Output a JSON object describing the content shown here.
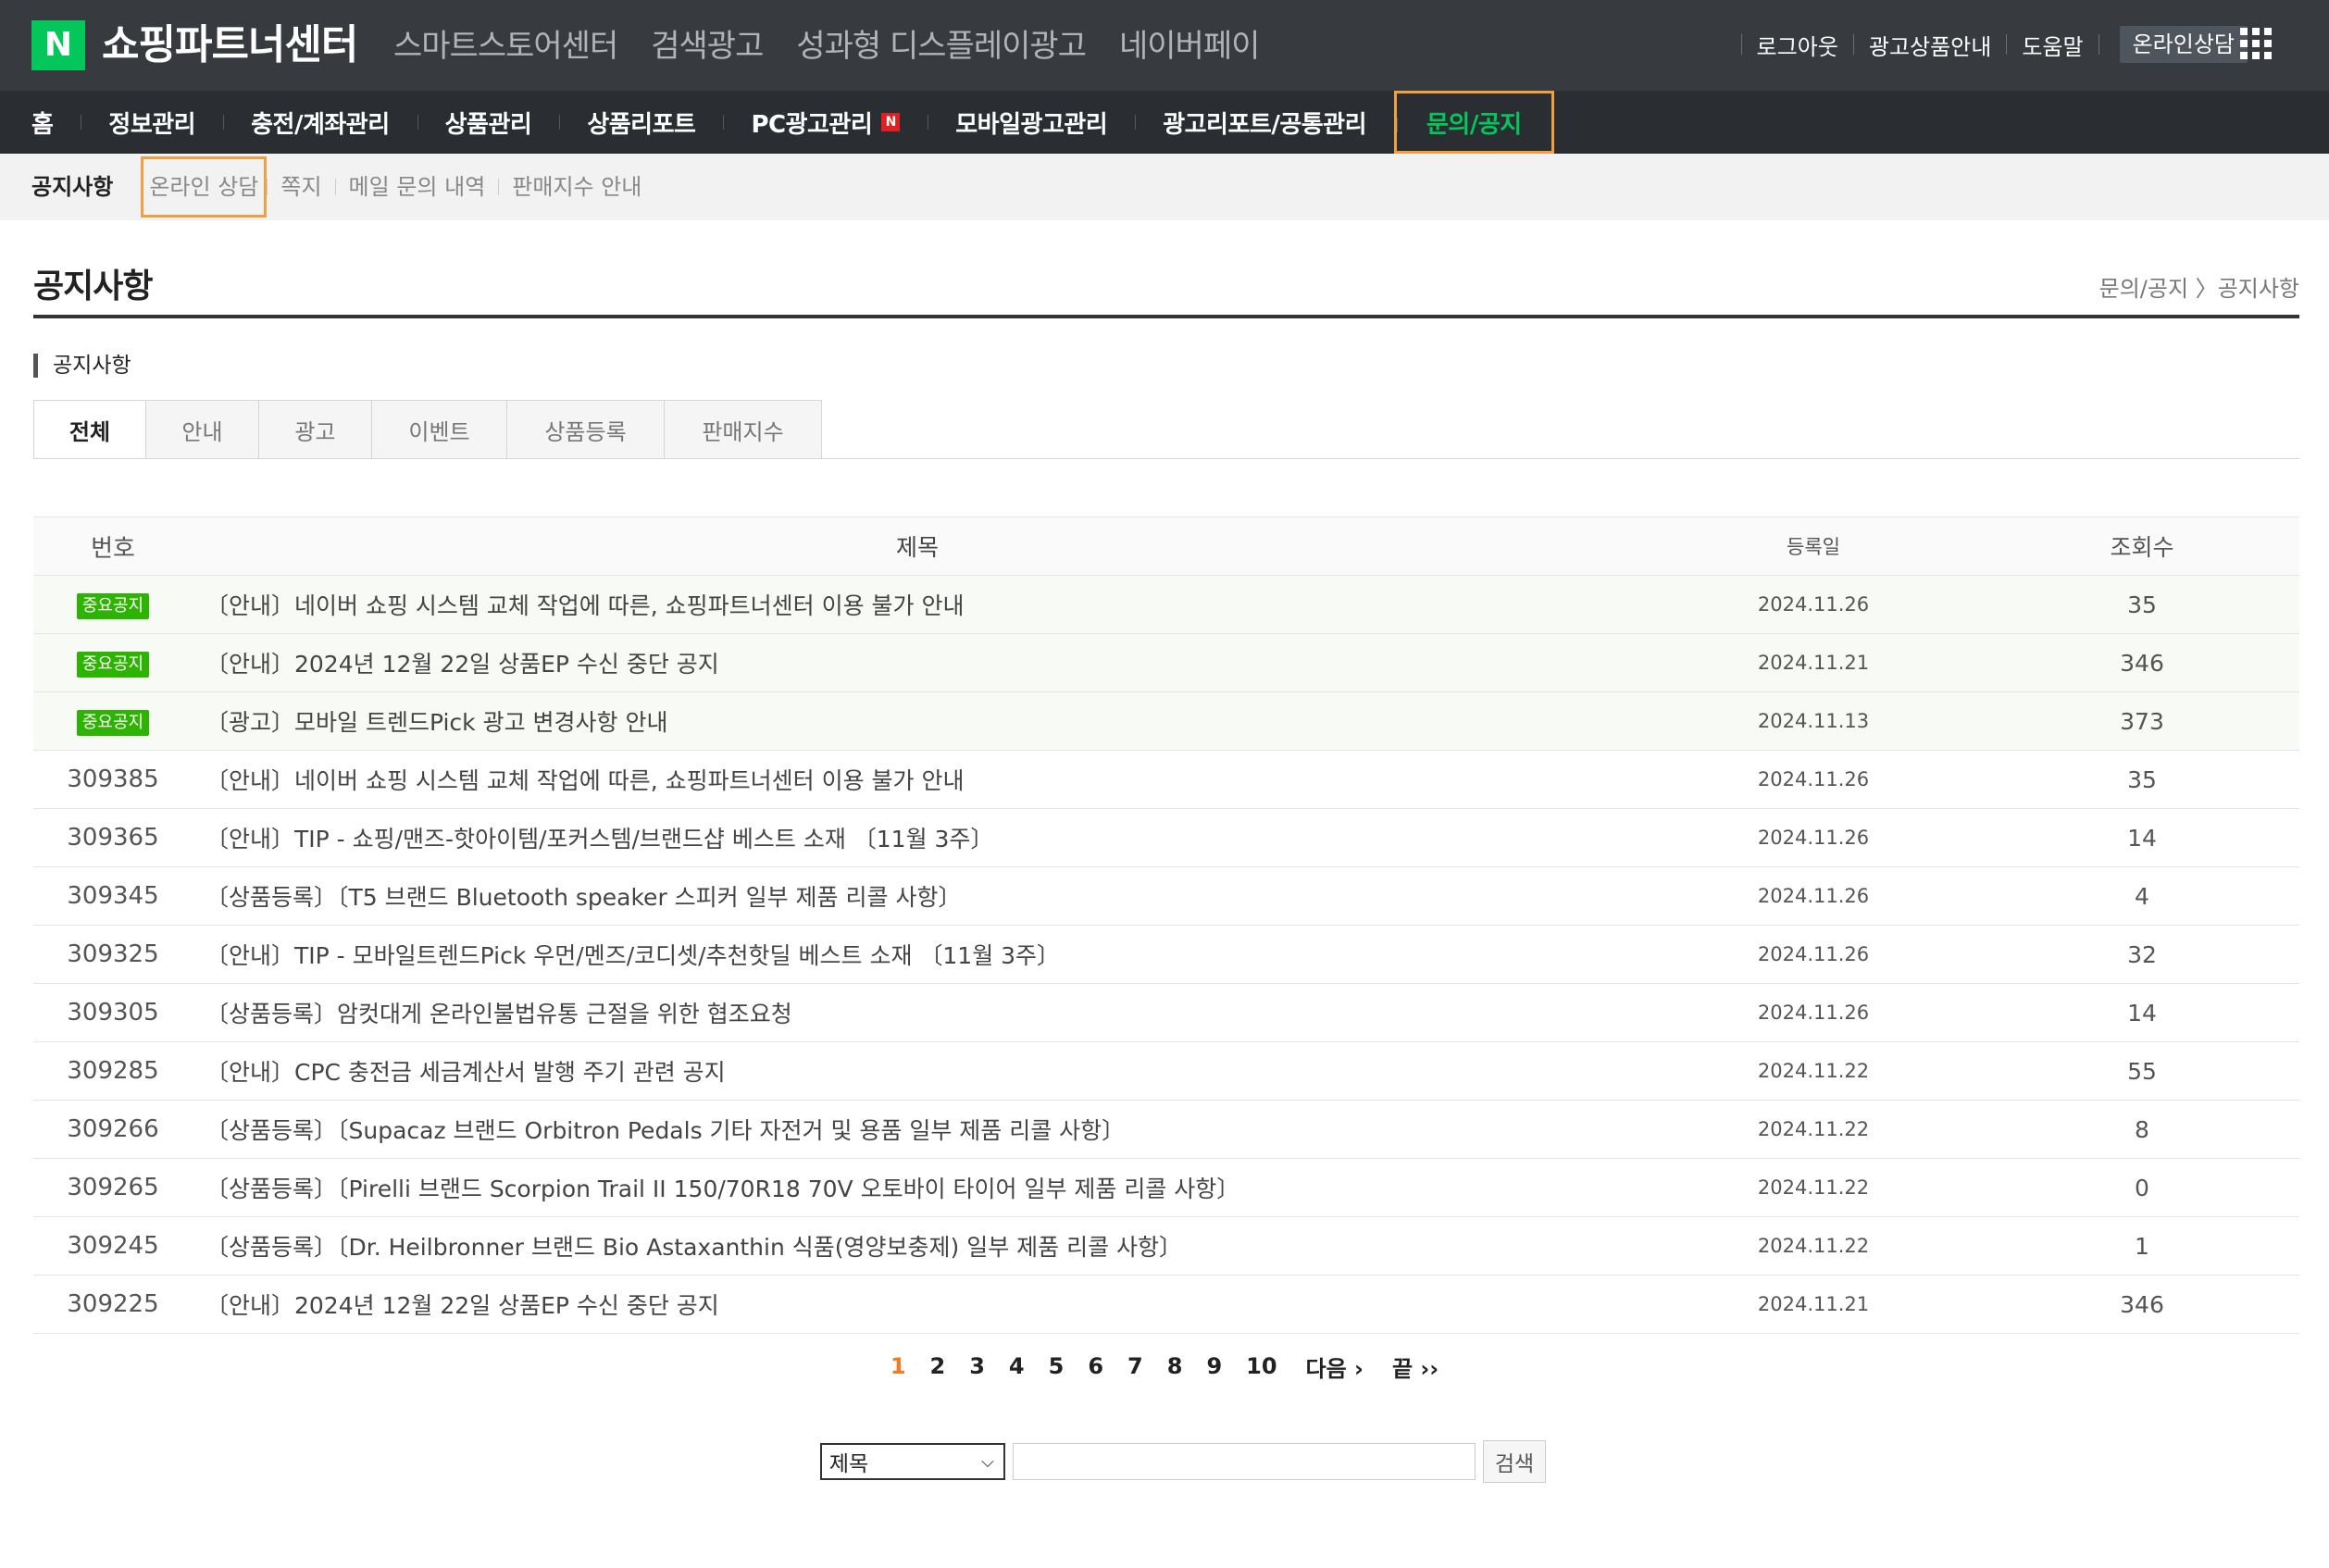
{
  "header": {
    "logo_letter": "N",
    "title": "쇼핑파트너센터",
    "menu": [
      "스마트스토어센터",
      "검색광고",
      "성과형 디스플레이광고",
      "네이버페이"
    ],
    "util": {
      "logout": "로그아웃",
      "ad_products": "광고상품안내",
      "help": "도움말",
      "online_consult": "온라인상담"
    }
  },
  "main_nav": {
    "items": [
      "홈",
      "정보관리",
      "충전/계좌관리",
      "상품관리",
      "상품리포트",
      "PC광고관리",
      "모바일광고관리",
      "광고리포트/공통관리",
      "문의/공지"
    ],
    "badge": "N"
  },
  "sub_nav": {
    "current": "공지사항",
    "items": [
      "온라인 상담",
      "쪽지",
      "메일 문의 내역",
      "판매지수 안내"
    ]
  },
  "page": {
    "title": "공지사항",
    "breadcrumb": "문의/공지 〉공지사항",
    "section_label": "공지사항"
  },
  "tabs": [
    "전체",
    "안내",
    "광고",
    "이벤트",
    "상품등록",
    "판매지수"
  ],
  "table": {
    "headers": {
      "num": "번호",
      "title": "제목",
      "date": "등록일",
      "views": "조회수"
    },
    "rows": [
      {
        "num": "중요공지",
        "title": "〔안내〕네이버 쇼핑 시스템 교체 작업에 따른, 쇼핑파트너센터 이용 불가 안내",
        "date": "2024.11.26",
        "views": "35"
      },
      {
        "num": "중요공지",
        "title": "〔안내〕2024년 12월 22일 상품EP 수신 중단 공지",
        "date": "2024.11.21",
        "views": "346"
      },
      {
        "num": "중요공지",
        "title": "〔광고〕모바일 트렌드Pick 광고 변경사항 안내",
        "date": "2024.11.13",
        "views": "373"
      },
      {
        "num": "309385",
        "title": "〔안내〕네이버 쇼핑 시스템 교체 작업에 따른, 쇼핑파트너센터 이용 불가 안내",
        "date": "2024.11.26",
        "views": "35"
      },
      {
        "num": "309365",
        "title": "〔안내〕TIP - 쇼핑/맨즈-핫아이템/포커스템/브랜드샵 베스트 소재 〔11월 3주〕",
        "date": "2024.11.26",
        "views": "14"
      },
      {
        "num": "309345",
        "title": "〔상품등록〕〔T5 브랜드 Bluetooth speaker 스피커 일부 제품 리콜 사항〕",
        "date": "2024.11.26",
        "views": "4"
      },
      {
        "num": "309325",
        "title": "〔안내〕TIP - 모바일트렌드Pick 우먼/멘즈/코디셋/추천핫딜 베스트 소재 〔11월 3주〕",
        "date": "2024.11.26",
        "views": "32"
      },
      {
        "num": "309305",
        "title": "〔상품등록〕암컷대게 온라인불법유통 근절을 위한 협조요청",
        "date": "2024.11.26",
        "views": "14"
      },
      {
        "num": "309285",
        "title": "〔안내〕CPC 충전금 세금계산서 발행 주기 관련 공지",
        "date": "2024.11.22",
        "views": "55"
      },
      {
        "num": "309266",
        "title": "〔상품등록〕〔Supacaz 브랜드 Orbitron Pedals 기타 자전거 및 용품 일부 제품 리콜 사항〕",
        "date": "2024.11.22",
        "views": "8"
      },
      {
        "num": "309265",
        "title": "〔상품등록〕〔Pirelli 브랜드 Scorpion Trail II 150/70R18 70V 오토바이 타이어 일부 제품 리콜 사항〕",
        "date": "2024.11.22",
        "views": "0"
      },
      {
        "num": "309245",
        "title": "〔상품등록〕〔Dr. Heilbronner 브랜드 Bio Astaxanthin 식품(영양보충제) 일부 제품 리콜 사항〕",
        "date": "2024.11.22",
        "views": "1"
      },
      {
        "num": "309225",
        "title": "〔안내〕2024년 12월 22일 상품EP 수신 중단 공지",
        "date": "2024.11.21",
        "views": "346"
      }
    ]
  },
  "pagination": {
    "pages": [
      "1",
      "2",
      "3",
      "4",
      "5",
      "6",
      "7",
      "8",
      "9",
      "10"
    ],
    "current": "1",
    "next": "다음 ›",
    "last": "끝 ››"
  },
  "search": {
    "select_value": "제목",
    "input_value": "",
    "button_label": "검색"
  },
  "colors": {
    "brand_green": "#03c75a",
    "highlight_orange": "#f0a040",
    "current_page": "#f47a20",
    "notice_badge": "#2db400"
  }
}
